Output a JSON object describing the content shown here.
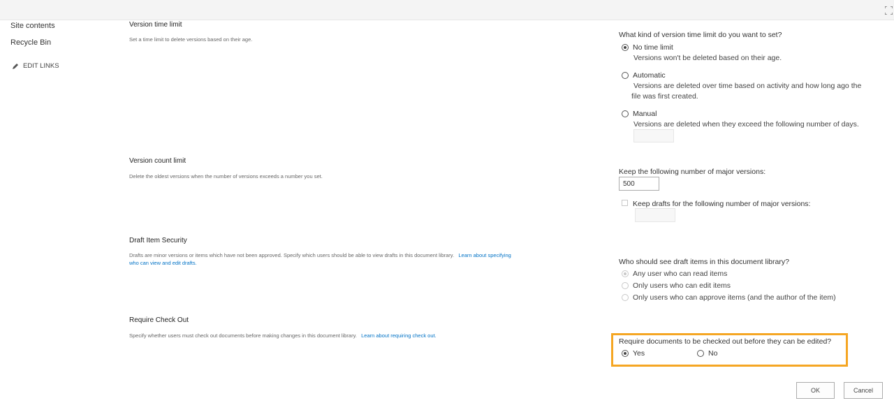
{
  "nav": {
    "site_contents": "Site contents",
    "recycle_bin": "Recycle Bin",
    "edit_links": "EDIT LINKS"
  },
  "version_time_limit": {
    "title": "Version time limit",
    "description": "Set a time limit to delete versions based on their age.",
    "question": "What kind of version time limit do you want to set?",
    "options": [
      {
        "label": "No time limit",
        "sub": "Versions won't be deleted based on their age.",
        "checked": true
      },
      {
        "label": "Automatic",
        "sub_line1": "Versions are deleted over time based on activity and how long ago the",
        "sub_line2": "file was first created.",
        "checked": false
      },
      {
        "label": "Manual",
        "sub": "Versions are deleted when they exceed the following number of days.",
        "checked": false
      }
    ],
    "days_value": ""
  },
  "version_count_limit": {
    "title": "Version count limit",
    "description": "Delete the oldest versions when the number of versions exceeds a number you set.",
    "major_label": "Keep the following number of major versions:",
    "major_value": "500",
    "drafts_label": "Keep drafts for the following number of major versions:",
    "drafts_checked": false,
    "drafts_value": ""
  },
  "draft_item_security": {
    "title": "Draft Item Security",
    "description": "Drafts are minor versions or items which have not been approved. Specify which users should be able to view drafts in this document library.",
    "link_line1": "Learn about specifying",
    "link_line2": "who can view and edit drafts.",
    "question": "Who should see draft items in this document library?",
    "options": [
      {
        "label": "Any user who can read items",
        "checked": true
      },
      {
        "label": "Only users who can edit items",
        "checked": false
      },
      {
        "label": "Only users who can approve items (and the author of the item)",
        "checked": false
      }
    ]
  },
  "require_check_out": {
    "title": "Require Check Out",
    "description": "Specify whether users must check out documents before making changes in this document library.",
    "link": "Learn about requiring check out.",
    "question": "Require documents to be checked out before they can be edited?",
    "yes_label": "Yes",
    "no_label": "No",
    "selected": "Yes",
    "highlight_color": "#f5a623"
  },
  "buttons": {
    "ok": "OK",
    "cancel": "Cancel"
  },
  "colors": {
    "link": "#0072c6",
    "topbar": "#f4f4f4"
  }
}
